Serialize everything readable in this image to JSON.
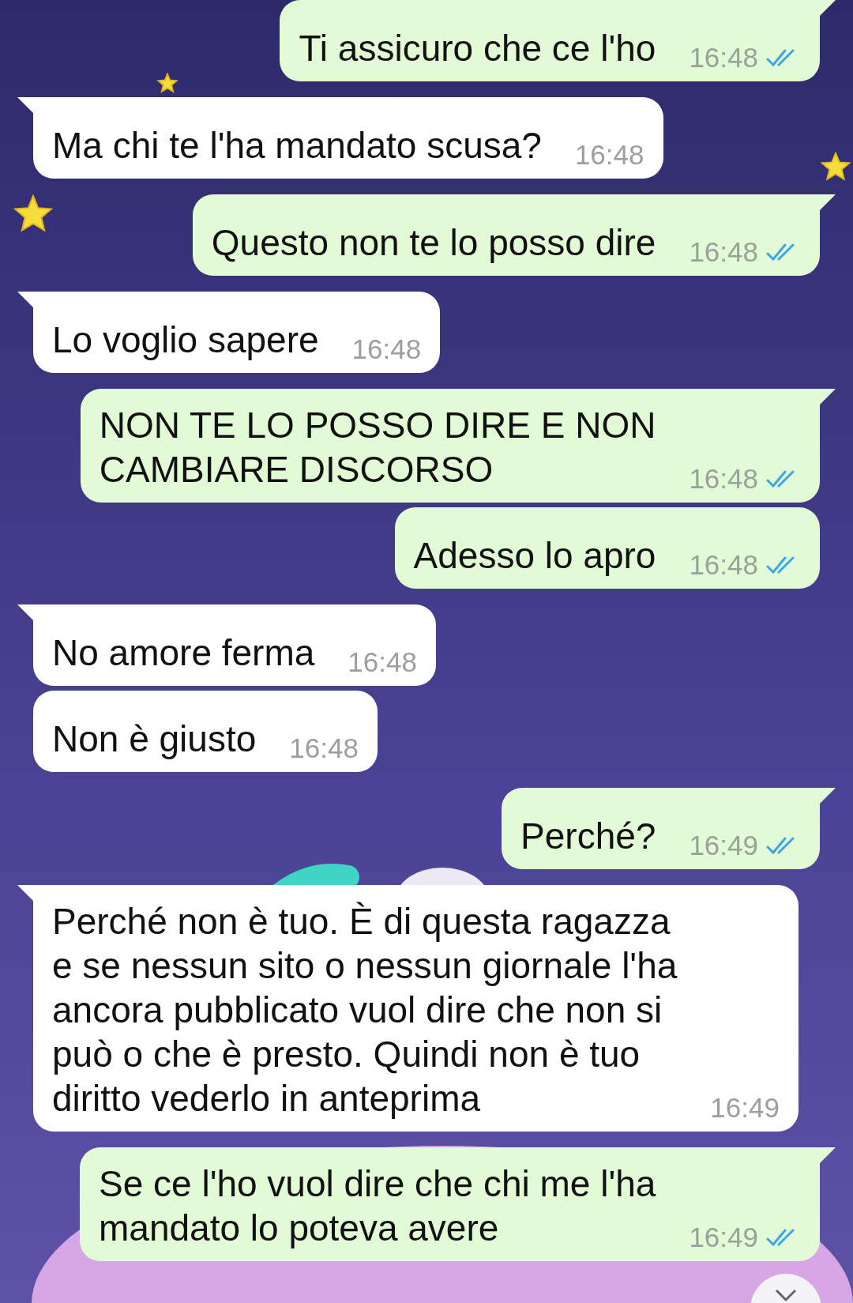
{
  "messages": [
    {
      "kind": "out",
      "tail": true,
      "lines": [
        "Ti assicuro che ce l'ho"
      ],
      "time": "16:48",
      "read": true
    },
    {
      "kind": "in",
      "tail": true,
      "lines": [
        "Ma chi te l'ha mandato scusa?"
      ],
      "time": "16:48"
    },
    {
      "kind": "out",
      "tail": true,
      "lines": [
        "Questo non te lo posso dire"
      ],
      "time": "16:48",
      "read": true
    },
    {
      "kind": "in",
      "tail": true,
      "lines": [
        "Lo voglio sapere"
      ],
      "time": "16:48"
    },
    {
      "kind": "out",
      "tail": true,
      "lines": [
        "NON TE LO POSSO DIRE E NON",
        "CAMBIARE DISCORSO"
      ],
      "time": "16:48",
      "read": true
    },
    {
      "kind": "out",
      "tail": false,
      "lines": [
        "Adesso lo apro"
      ],
      "time": "16:48",
      "read": true
    },
    {
      "kind": "in",
      "tail": true,
      "lines": [
        "No amore ferma"
      ],
      "time": "16:48"
    },
    {
      "kind": "in",
      "tail": false,
      "lines": [
        "Non è giusto"
      ],
      "time": "16:48"
    },
    {
      "kind": "out",
      "tail": true,
      "lines": [
        "Perché?"
      ],
      "time": "16:49",
      "read": true
    },
    {
      "kind": "in",
      "tail": true,
      "lines": [
        "Perché non è tuo. È di questa ragazza",
        "e se nessun sito o nessun giornale l'ha",
        "ancora pubblicato vuol dire che non si",
        "può o che è presto. Quindi non è tuo",
        "diritto vederlo in anteprima"
      ],
      "time": "16:49"
    },
    {
      "kind": "out",
      "tail": true,
      "lines": [
        "Se ce l'ho vuol dire che chi me l'ha",
        "mandato lo poteva avere"
      ],
      "time": "16:49",
      "read": true
    }
  ]
}
